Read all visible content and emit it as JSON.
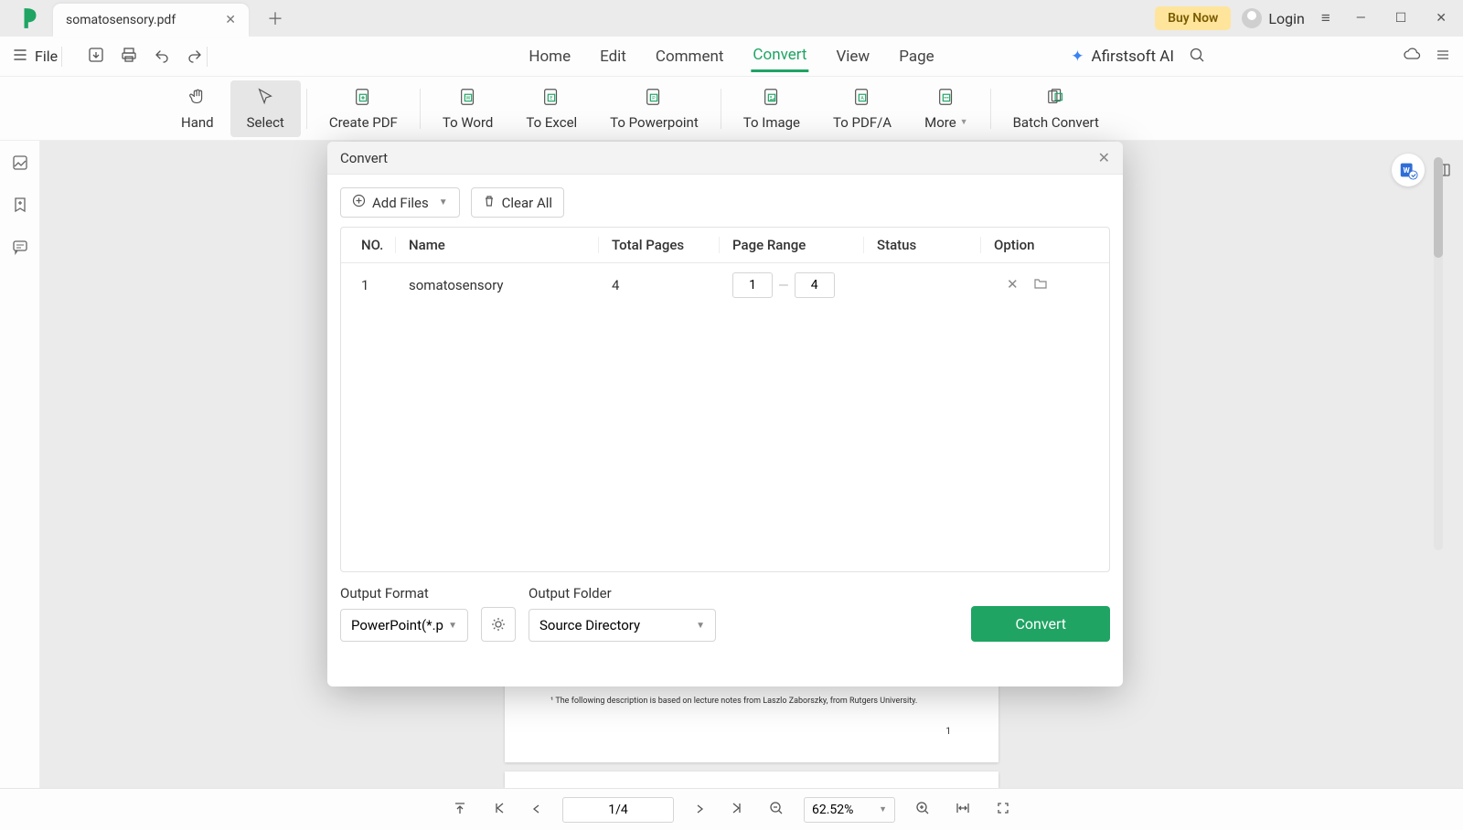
{
  "titleBar": {
    "tabTitle": "somatosensory.pdf",
    "buyNow": "Buy Now",
    "login": "Login"
  },
  "toolbar": {
    "fileLabel": "File"
  },
  "mainTabs": {
    "home": "Home",
    "edit": "Edit",
    "comment": "Comment",
    "convert": "Convert",
    "view": "View",
    "page": "Page"
  },
  "ai": {
    "label": "Afirstsoft AI"
  },
  "ribbon": {
    "hand": "Hand",
    "select": "Select",
    "createPdf": "Create PDF",
    "toWord": "To Word",
    "toExcel": "To Excel",
    "toPowerpoint": "To Powerpoint",
    "toImage": "To Image",
    "toPdfa": "To PDF/A",
    "more": "More",
    "batchConvert": "Batch Convert"
  },
  "modal": {
    "title": "Convert",
    "addFiles": "Add Files",
    "clearAll": "Clear All",
    "headers": {
      "no": "NO.",
      "name": "Name",
      "totalPages": "Total Pages",
      "pageRange": "Page Range",
      "status": "Status",
      "option": "Option"
    },
    "rows": [
      {
        "no": "1",
        "name": "somatosensory",
        "totalPages": "4",
        "rangeFrom": "1",
        "rangeTo": "4",
        "status": ""
      }
    ],
    "outputFormatLabel": "Output Format",
    "outputFormatValue": "PowerPoint(*.p",
    "outputFolderLabel": "Output Folder",
    "outputFolderValue": "Source Directory",
    "convertBtn": "Convert"
  },
  "docPreview": {
    "footnote": "¹ The following description is based on lecture notes from Laszlo Zaborszky, from Rutgers University.",
    "pageNumber": "1"
  },
  "bottomBar": {
    "pageIndicator": "1/4",
    "zoomValue": "62.52%"
  }
}
